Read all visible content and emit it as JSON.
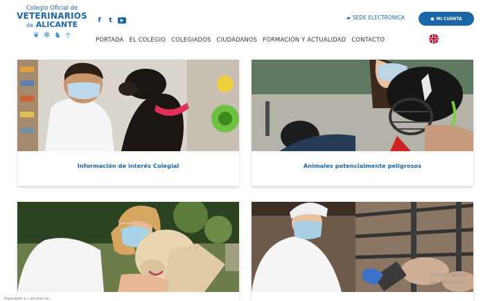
{
  "logo": {
    "line1": "Colegio Oficial de",
    "line2": "VETERINARIOS",
    "line3_prefix": "de",
    "line3": "ALICANTE"
  },
  "social": [
    "f",
    "t",
    "▶"
  ],
  "header": {
    "sede_label": "SEDE ELECTRÓNICA",
    "cuenta_label": "MI CUENTA"
  },
  "nav": [
    "PORTADA",
    "EL COLEGIO",
    "COLEGIADOS",
    "CIUDADANOS",
    "FORMACIÓN Y ACTUALIDAD",
    "CONTACTO"
  ],
  "cards": [
    {
      "caption": "Información de interés Colegial"
    },
    {
      "caption": "Animales potencialmente peligrosos"
    },
    {
      "caption": ""
    },
    {
      "caption": ""
    }
  ],
  "watermark": {
    "line1": "Activar Windo",
    "line2": "Ve a Configuració"
  },
  "status": "Esperando a c-alicante.es..."
}
